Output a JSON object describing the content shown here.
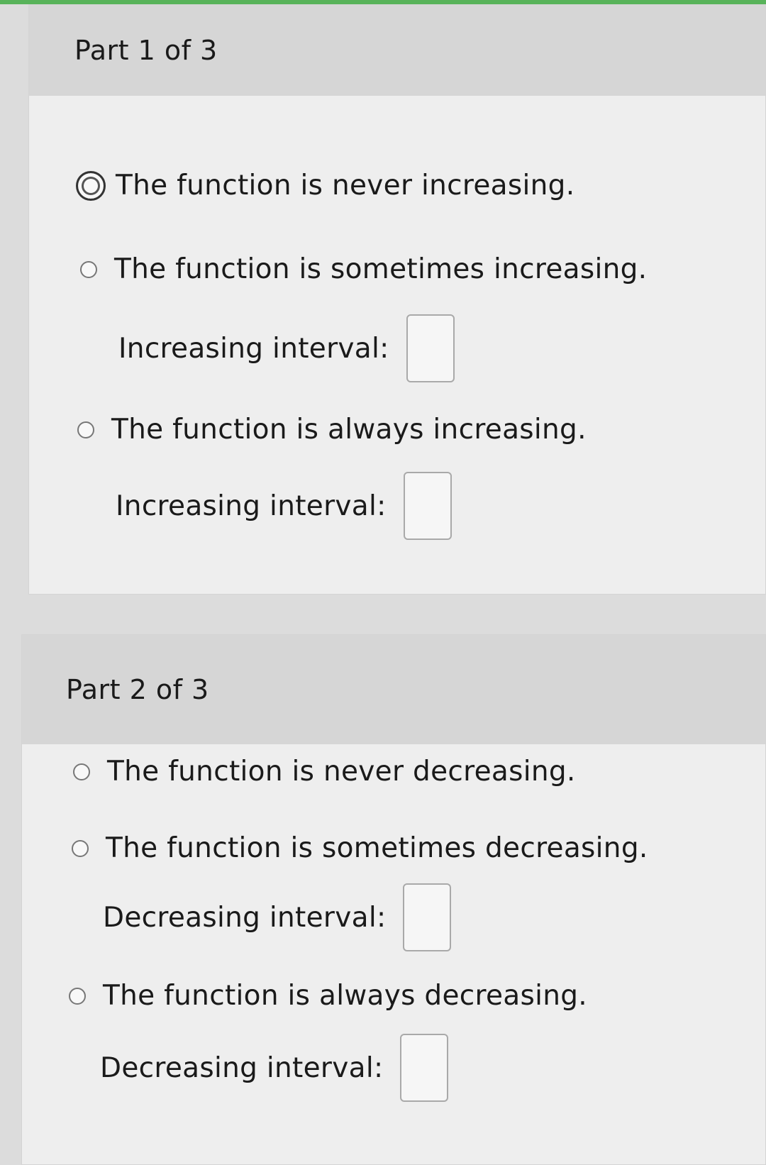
{
  "part1": {
    "title": "Part 1 of 3",
    "options": [
      {
        "label": "The function is never increasing.",
        "selected": true
      },
      {
        "label": "The function is sometimes increasing.",
        "selected": false
      },
      {
        "label": "The function is always increasing.",
        "selected": false
      }
    ],
    "interval_label": "Increasing interval:",
    "interval_values": [
      "",
      ""
    ]
  },
  "part2": {
    "title": "Part 2 of 3",
    "options": [
      {
        "label": "The function is never decreasing.",
        "selected": false
      },
      {
        "label": "The function is sometimes decreasing.",
        "selected": false
      },
      {
        "label": "The function is always decreasing.",
        "selected": false
      }
    ],
    "interval_label": "Decreasing interval:",
    "interval_values": [
      "",
      ""
    ]
  },
  "colors": {
    "top_strip": "#58b35a",
    "header_bg": "#d6d6d6",
    "card_bg": "#eeeeee",
    "text": "#1a1a1a"
  }
}
